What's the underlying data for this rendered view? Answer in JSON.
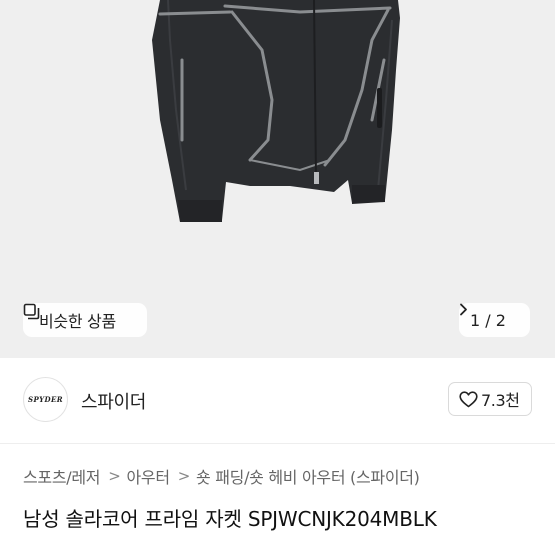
{
  "gallery": {
    "similar_label": "비슷한 상품",
    "similar_icon": "copy-icon",
    "page_indicator": "1 / 2",
    "next_icon": "chevron-right-icon"
  },
  "seller": {
    "logo_text": "SPYDER",
    "name": "스파이더",
    "like_icon": "heart-icon",
    "like_count": "7.3천"
  },
  "breadcrumb": {
    "items": [
      "스포츠/레저",
      "아우터",
      "숏 패딩/숏 헤비 아우터 (스파이더)"
    ],
    "separator": ">"
  },
  "product": {
    "title": "남성 솔라코어 프라임 자켓 SPJWCNJK204MBLK"
  },
  "colors": {
    "hero_background": "#efefef",
    "jacket": "#2b2d30",
    "seam": "#8a8d90"
  }
}
